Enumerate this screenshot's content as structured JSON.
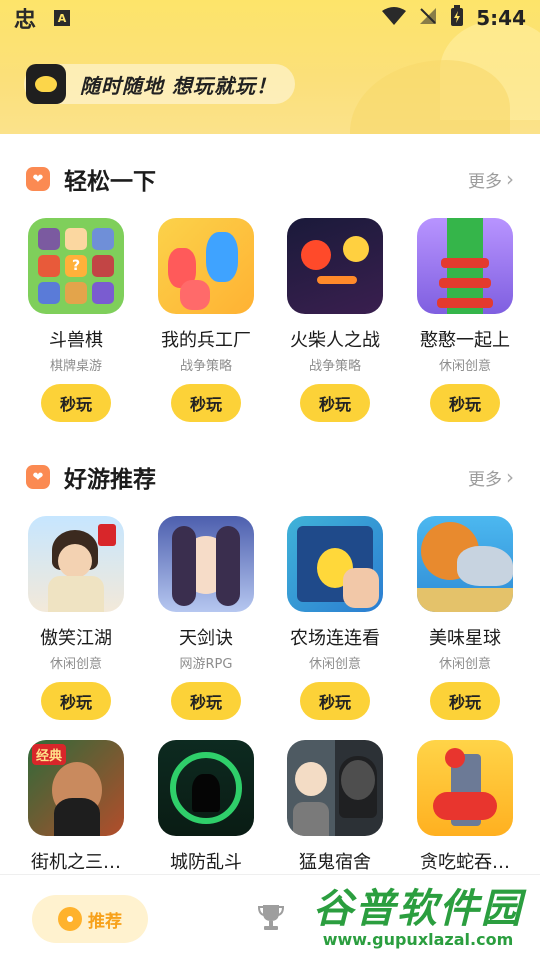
{
  "status_bar": {
    "app_glyph": "忠",
    "a_label": "A",
    "time": "5:44"
  },
  "banner": {
    "slogan": "随时随地 想玩就玩！"
  },
  "sections": [
    {
      "title": "轻松一下",
      "more": "更多",
      "games": [
        {
          "name": "斗兽棋",
          "category": "棋牌桌游",
          "play": "秒玩"
        },
        {
          "name": "我的兵工厂",
          "category": "战争策略",
          "play": "秒玩"
        },
        {
          "name": "火柴人之战",
          "category": "战争策略",
          "play": "秒玩"
        },
        {
          "name": "憨憨一起上",
          "category": "休闲创意",
          "play": "秒玩"
        }
      ]
    },
    {
      "title": "好游推荐",
      "more": "更多",
      "games": [
        {
          "name": "傲笑江湖",
          "category": "休闲创意",
          "play": "秒玩"
        },
        {
          "name": "天剑诀",
          "category": "网游RPG",
          "play": "秒玩"
        },
        {
          "name": "农场连连看",
          "category": "休闲创意",
          "play": "秒玩"
        },
        {
          "name": "美味星球",
          "category": "休闲创意",
          "play": "秒玩"
        }
      ],
      "games_row2": [
        {
          "name": "街机之三…"
        },
        {
          "name": "城防乱斗"
        },
        {
          "name": "猛鬼宿舍"
        },
        {
          "name": "贪吃蛇吞…"
        }
      ],
      "jieji_badge": "经典"
    }
  ],
  "bottom_nav": {
    "tab_recommend": "推荐"
  },
  "watermark": {
    "big": "谷普软件园",
    "small": "www.gupuxlazal.com"
  },
  "colors": {
    "header_yellow": "#fde46a",
    "button_yellow": "#fcd238",
    "section_icon": "#fb8a52",
    "nav_active": "#f7a11a",
    "watermark_green": "#2b9e3f"
  }
}
